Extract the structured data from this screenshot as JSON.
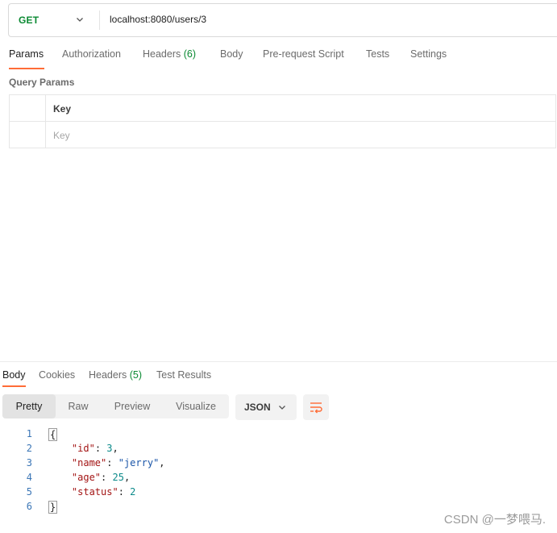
{
  "request": {
    "method": "GET",
    "url": "localhost:8080/users/3",
    "tabs": [
      {
        "label": "Params"
      },
      {
        "label": "Authorization"
      },
      {
        "label": "Headers",
        "count": "(6)"
      },
      {
        "label": "Body"
      },
      {
        "label": "Pre-request Script"
      },
      {
        "label": "Tests"
      },
      {
        "label": "Settings"
      }
    ],
    "active_tab": "Params",
    "query_params_title": "Query Params",
    "table": {
      "header_key": "Key",
      "key_placeholder": "Key"
    }
  },
  "response": {
    "tabs": [
      {
        "label": "Body"
      },
      {
        "label": "Cookies"
      },
      {
        "label": "Headers",
        "count": "(5)"
      },
      {
        "label": "Test Results"
      }
    ],
    "active_tab": "Body",
    "view_modes": [
      "Pretty",
      "Raw",
      "Preview",
      "Visualize"
    ],
    "active_view": "Pretty",
    "format": "JSON",
    "code_lines": [
      {
        "n": "1",
        "text": "{"
      },
      {
        "n": "2",
        "key": "\"id\"",
        "value": "3",
        "value_type": "number",
        "trail": ","
      },
      {
        "n": "3",
        "key": "\"name\"",
        "value": "\"jerry\"",
        "value_type": "string",
        "trail": ","
      },
      {
        "n": "4",
        "key": "\"age\"",
        "value": "25",
        "value_type": "number",
        "trail": ","
      },
      {
        "n": "5",
        "key": "\"status\"",
        "value": "2",
        "value_type": "number",
        "trail": ""
      },
      {
        "n": "6",
        "text": "}"
      }
    ]
  },
  "watermark": "CSDN @一梦喂马.",
  "colors": {
    "accent": "#ff6c37",
    "method_get": "#0b8a33",
    "json_key": "#a31515",
    "json_number": "#0b8a8a",
    "json_string": "#1a55a8",
    "line_number": "#3b76b6"
  },
  "icons": {
    "method_dropdown": "chevron-down-icon",
    "format_dropdown": "chevron-down-icon",
    "wrap": "wrap-lines-icon"
  }
}
